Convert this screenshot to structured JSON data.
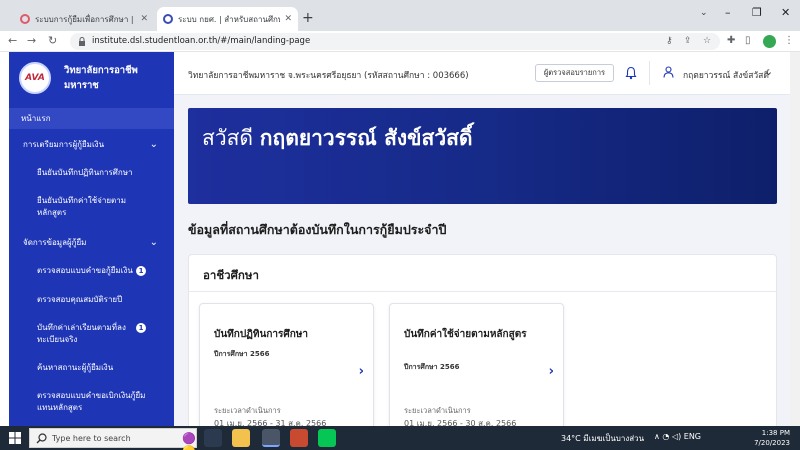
{
  "browser": {
    "tabs": [
      {
        "title": "ระบบการกู้ยืมเพื่อการศึกษา | กองทุนเงินให้กู้ยืม...",
        "active": false
      },
      {
        "title": "ระบบ กยศ. | สำหรับสถานศึกษา",
        "active": true
      }
    ],
    "new_tab": "+",
    "url": "institute.dsl.studentloan.or.th/#/main/landing-page",
    "window_controls": {
      "minimize": "–",
      "restore": "❐",
      "close": "✕"
    }
  },
  "sidebar": {
    "brand_name": "วิทยาลัยการอาชีพ มหาราช",
    "logo_text": "AVA",
    "items": [
      {
        "label": "หน้าแรก",
        "type": "home"
      },
      {
        "label": "การเตรียมการผู้กู้ยืมเงิน",
        "type": "group"
      },
      {
        "label": "ยืนยันบันทึกปฏิทินการศึกษา",
        "type": "sub"
      },
      {
        "label": "ยืนยันบันทึกค่าใช้จ่ายตามหลักสูตร",
        "type": "sub"
      },
      {
        "label": "จัดการข้อมูลผู้กู้ยืม",
        "type": "group"
      },
      {
        "label": "ตรวจสอบแบบคำขอกู้ยืมเงิน",
        "type": "sub",
        "badge": "1"
      },
      {
        "label": "ตรวจสอบคุณสมบัติรายปี",
        "type": "sub"
      },
      {
        "label": "บันทึกค่าเล่าเรียนตามที่ลงทะเบียนจริง",
        "type": "sub",
        "badge": "1"
      },
      {
        "label": "ค้นหาสถานะผู้กู้ยืมเงิน",
        "type": "sub"
      },
      {
        "label": "ตรวจสอบแบบคำขอเบิกเงินกู้ยืมแทนหลักสูตร",
        "type": "sub"
      }
    ]
  },
  "topbar": {
    "school_line": "วิทยาลัยการอาชีพมหาราช จ.พระนครศรีอยุธยา (รหัสสถานศึกษา : 003666)",
    "verify_button": "ผู้ตรวจสอบรายการ",
    "user_name": "กฤตยาวรรณ์ สังข์สวัสดิ์"
  },
  "banner": {
    "greeting": "สวัสดี",
    "name": "กฤตยาวรรณ์ สังข์สวัสดิ์",
    "color_start": "#1e2f9e",
    "color_end": "#0e1f6a"
  },
  "section_heading": "ข้อมูลที่สถานศึกษาต้องบันทึกในการกู้ยืมประจำปี",
  "panel": {
    "title": "อาชีวศึกษา",
    "cards": [
      {
        "title": "บันทึกปฏิทินการศึกษา",
        "subtitle": "ปีการศึกษา 2566",
        "period_label": "ระยะเวลาดำเนินการ",
        "period": "01 เม.ย. 2566 - 31 ส.ค. 2566"
      },
      {
        "title": "บันทึกค่าใช้จ่ายตามหลักสูตร",
        "subtitle": "ปีการศึกษา 2566",
        "period_label": "ระยะเวลาดำเนินการ",
        "period": "01 เม.ย. 2566 - 30 ส.ค. 2566"
      }
    ]
  },
  "taskbar": {
    "search_placeholder": "Type here to search",
    "weather": "34°C มีเมฆเป็นบางส่วน",
    "language": "ENG",
    "time": "1:38 PM",
    "date": "7/20/2023"
  },
  "accent": "#1e35b5"
}
